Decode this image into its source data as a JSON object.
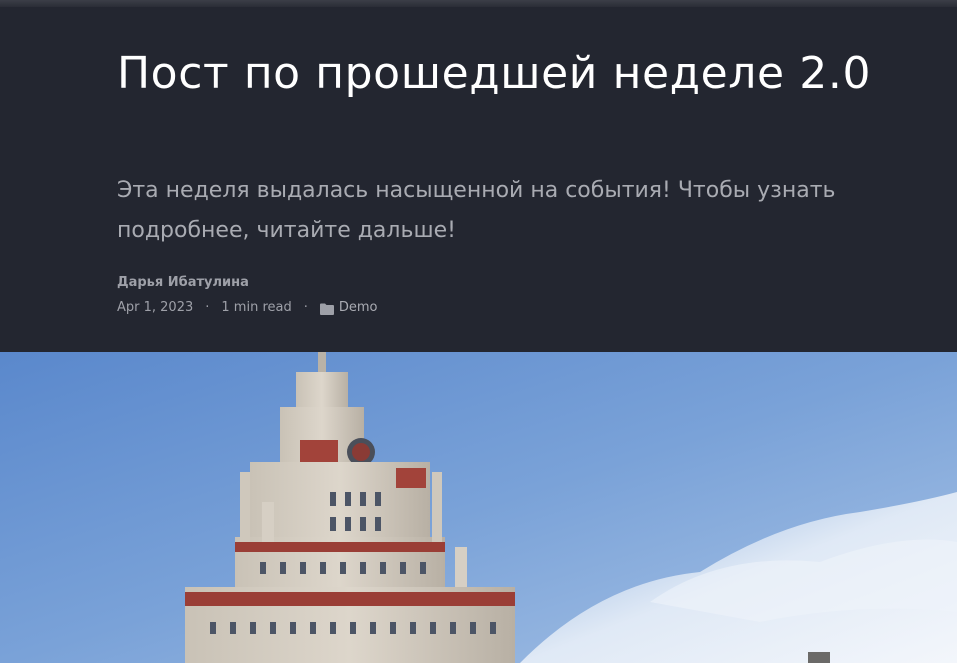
{
  "post": {
    "title": "Пост по прошедшей неделе 2.0",
    "subtitle": "Эта неделя выдалась насыщенной на события! Чтобы узнать подробнее, читайте дальше!",
    "author": "Дарья Ибатулина",
    "date": "Apr 1, 2023",
    "separator": "·",
    "read_time": "1 min read",
    "category": "Demo",
    "category_icon": "folder-icon"
  },
  "colors": {
    "header_bg": "#232630",
    "title": "#ffffff",
    "muted_text": "#9ea0a8",
    "sky": "#6f98d2"
  },
  "hero_image": {
    "subject": "stalinist-skyscraper-photo"
  }
}
